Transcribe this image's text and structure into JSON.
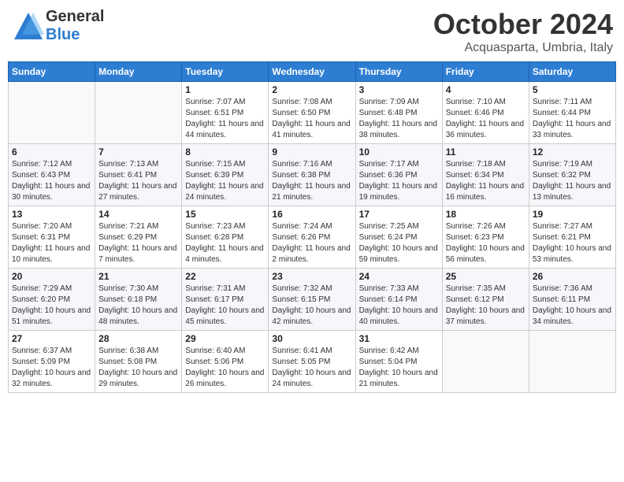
{
  "header": {
    "logo_general": "General",
    "logo_blue": "Blue",
    "month": "October 2024",
    "location": "Acquasparta, Umbria, Italy"
  },
  "days_of_week": [
    "Sunday",
    "Monday",
    "Tuesday",
    "Wednesday",
    "Thursday",
    "Friday",
    "Saturday"
  ],
  "weeks": [
    [
      {
        "day": "",
        "info": ""
      },
      {
        "day": "",
        "info": ""
      },
      {
        "day": "1",
        "info": "Sunrise: 7:07 AM\nSunset: 6:51 PM\nDaylight: 11 hours and 44 minutes."
      },
      {
        "day": "2",
        "info": "Sunrise: 7:08 AM\nSunset: 6:50 PM\nDaylight: 11 hours and 41 minutes."
      },
      {
        "day": "3",
        "info": "Sunrise: 7:09 AM\nSunset: 6:48 PM\nDaylight: 11 hours and 38 minutes."
      },
      {
        "day": "4",
        "info": "Sunrise: 7:10 AM\nSunset: 6:46 PM\nDaylight: 11 hours and 36 minutes."
      },
      {
        "day": "5",
        "info": "Sunrise: 7:11 AM\nSunset: 6:44 PM\nDaylight: 11 hours and 33 minutes."
      }
    ],
    [
      {
        "day": "6",
        "info": "Sunrise: 7:12 AM\nSunset: 6:43 PM\nDaylight: 11 hours and 30 minutes."
      },
      {
        "day": "7",
        "info": "Sunrise: 7:13 AM\nSunset: 6:41 PM\nDaylight: 11 hours and 27 minutes."
      },
      {
        "day": "8",
        "info": "Sunrise: 7:15 AM\nSunset: 6:39 PM\nDaylight: 11 hours and 24 minutes."
      },
      {
        "day": "9",
        "info": "Sunrise: 7:16 AM\nSunset: 6:38 PM\nDaylight: 11 hours and 21 minutes."
      },
      {
        "day": "10",
        "info": "Sunrise: 7:17 AM\nSunset: 6:36 PM\nDaylight: 11 hours and 19 minutes."
      },
      {
        "day": "11",
        "info": "Sunrise: 7:18 AM\nSunset: 6:34 PM\nDaylight: 11 hours and 16 minutes."
      },
      {
        "day": "12",
        "info": "Sunrise: 7:19 AM\nSunset: 6:32 PM\nDaylight: 11 hours and 13 minutes."
      }
    ],
    [
      {
        "day": "13",
        "info": "Sunrise: 7:20 AM\nSunset: 6:31 PM\nDaylight: 11 hours and 10 minutes."
      },
      {
        "day": "14",
        "info": "Sunrise: 7:21 AM\nSunset: 6:29 PM\nDaylight: 11 hours and 7 minutes."
      },
      {
        "day": "15",
        "info": "Sunrise: 7:23 AM\nSunset: 6:28 PM\nDaylight: 11 hours and 4 minutes."
      },
      {
        "day": "16",
        "info": "Sunrise: 7:24 AM\nSunset: 6:26 PM\nDaylight: 11 hours and 2 minutes."
      },
      {
        "day": "17",
        "info": "Sunrise: 7:25 AM\nSunset: 6:24 PM\nDaylight: 10 hours and 59 minutes."
      },
      {
        "day": "18",
        "info": "Sunrise: 7:26 AM\nSunset: 6:23 PM\nDaylight: 10 hours and 56 minutes."
      },
      {
        "day": "19",
        "info": "Sunrise: 7:27 AM\nSunset: 6:21 PM\nDaylight: 10 hours and 53 minutes."
      }
    ],
    [
      {
        "day": "20",
        "info": "Sunrise: 7:29 AM\nSunset: 6:20 PM\nDaylight: 10 hours and 51 minutes."
      },
      {
        "day": "21",
        "info": "Sunrise: 7:30 AM\nSunset: 6:18 PM\nDaylight: 10 hours and 48 minutes."
      },
      {
        "day": "22",
        "info": "Sunrise: 7:31 AM\nSunset: 6:17 PM\nDaylight: 10 hours and 45 minutes."
      },
      {
        "day": "23",
        "info": "Sunrise: 7:32 AM\nSunset: 6:15 PM\nDaylight: 10 hours and 42 minutes."
      },
      {
        "day": "24",
        "info": "Sunrise: 7:33 AM\nSunset: 6:14 PM\nDaylight: 10 hours and 40 minutes."
      },
      {
        "day": "25",
        "info": "Sunrise: 7:35 AM\nSunset: 6:12 PM\nDaylight: 10 hours and 37 minutes."
      },
      {
        "day": "26",
        "info": "Sunrise: 7:36 AM\nSunset: 6:11 PM\nDaylight: 10 hours and 34 minutes."
      }
    ],
    [
      {
        "day": "27",
        "info": "Sunrise: 6:37 AM\nSunset: 5:09 PM\nDaylight: 10 hours and 32 minutes."
      },
      {
        "day": "28",
        "info": "Sunrise: 6:38 AM\nSunset: 5:08 PM\nDaylight: 10 hours and 29 minutes."
      },
      {
        "day": "29",
        "info": "Sunrise: 6:40 AM\nSunset: 5:06 PM\nDaylight: 10 hours and 26 minutes."
      },
      {
        "day": "30",
        "info": "Sunrise: 6:41 AM\nSunset: 5:05 PM\nDaylight: 10 hours and 24 minutes."
      },
      {
        "day": "31",
        "info": "Sunrise: 6:42 AM\nSunset: 5:04 PM\nDaylight: 10 hours and 21 minutes."
      },
      {
        "day": "",
        "info": ""
      },
      {
        "day": "",
        "info": ""
      }
    ]
  ]
}
